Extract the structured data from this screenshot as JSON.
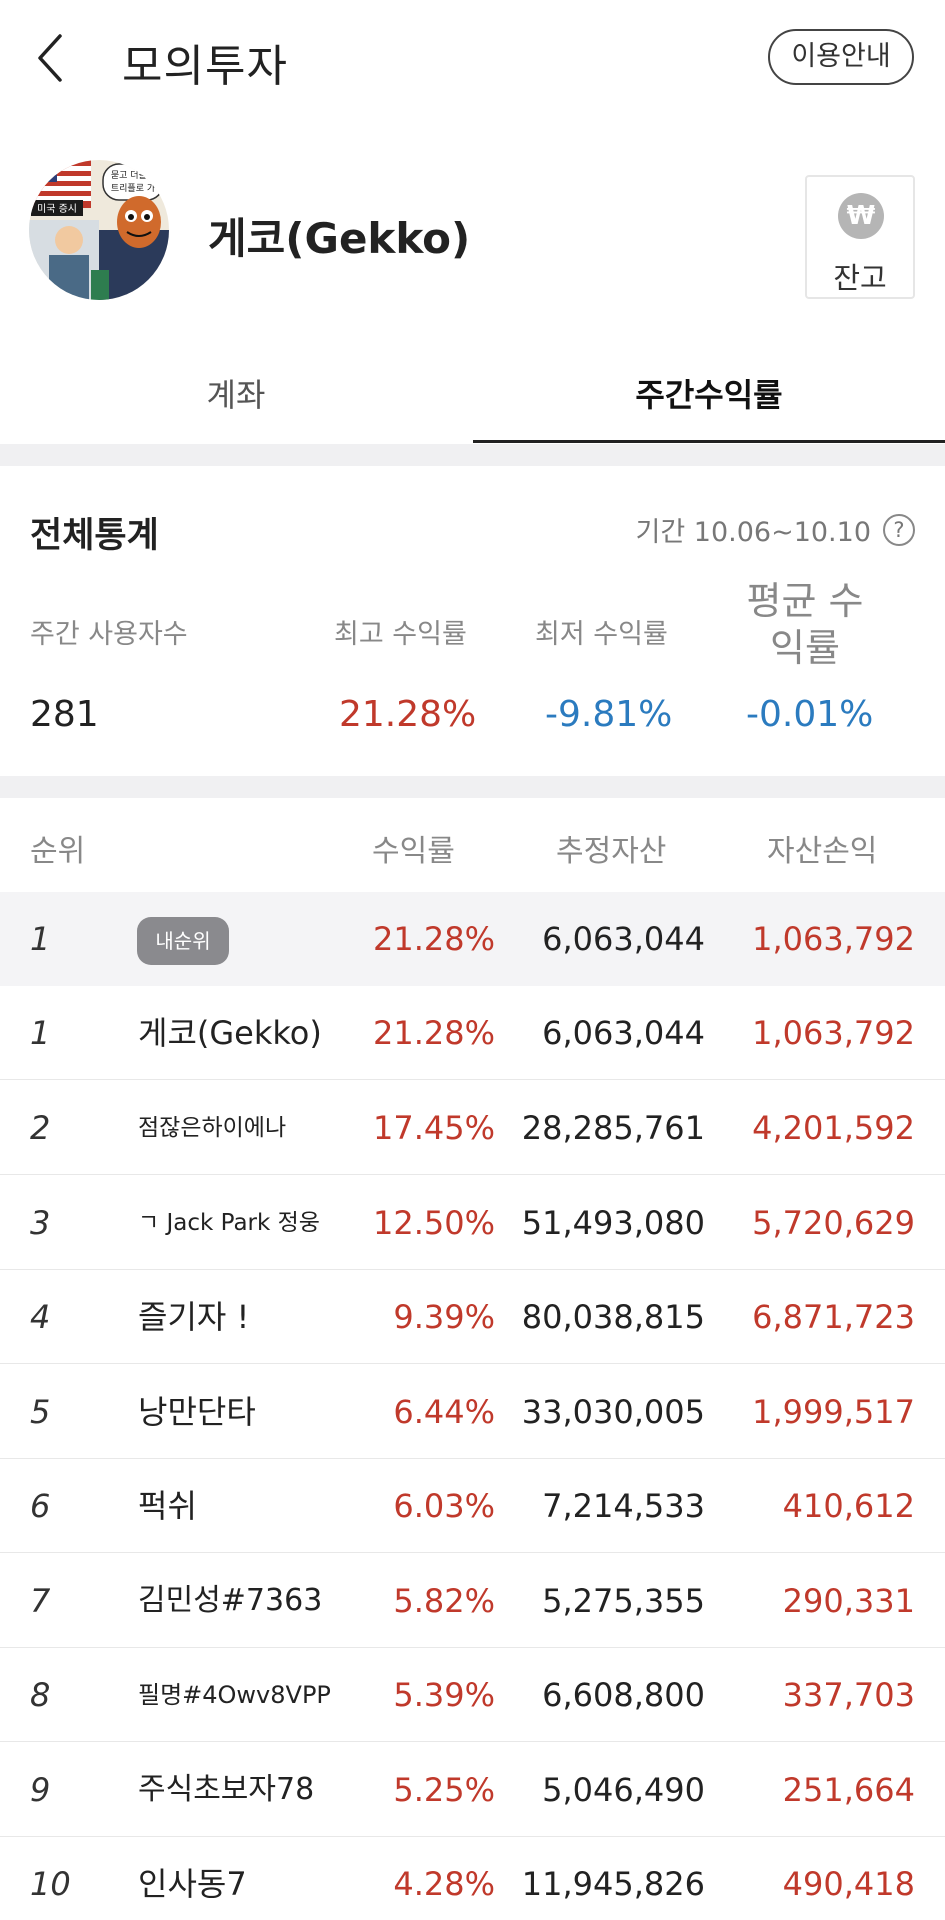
{
  "header": {
    "title": "모의투자",
    "guide_button": "이용안내"
  },
  "profile": {
    "name": "게코(Gekko)",
    "balance_label": "잔고",
    "balance_icon": "won-icon",
    "avatar_text": [
      "미국 증시",
      "묻고 더블로",
      "트리플로 가"
    ]
  },
  "tabs": [
    {
      "label": "계좌",
      "selected": false
    },
    {
      "label": "주간수익률",
      "selected": true
    }
  ],
  "stats": {
    "title": "전체통계",
    "period": "기간 10.06~10.10",
    "weekly_users_label": "주간 사용자수",
    "weekly_users": "281",
    "max_return_label": "최고 수익률",
    "max_return": "21.28%",
    "min_return_label": "최저 수익률",
    "min_return": "-9.81%",
    "avg_return_label": "평균 수익률",
    "avg_return": "-0.01%"
  },
  "table": {
    "headers": {
      "rank": "순위",
      "return": "수익률",
      "asset": "추정자산",
      "pnl": "자산손익"
    },
    "my_badge": "내순위",
    "my_row": {
      "rank": "1",
      "return": "21.28%",
      "asset": "6,063,044",
      "pnl": "1,063,792"
    },
    "rows": [
      {
        "rank": "1",
        "name": "게코(Gekko)",
        "return": "21.28%",
        "asset": "6,063,044",
        "pnl": "1,063,792"
      },
      {
        "rank": "2",
        "name": "점잖은하이에나",
        "return": "17.45%",
        "asset": "28,285,761",
        "pnl": "4,201,592"
      },
      {
        "rank": "3",
        "name": "ㄱ Jack Park 정웅",
        "return": "12.50%",
        "asset": "51,493,080",
        "pnl": "5,720,629"
      },
      {
        "rank": "4",
        "name": "즐기자 !",
        "return": "9.39%",
        "asset": "80,038,815",
        "pnl": "6,871,723"
      },
      {
        "rank": "5",
        "name": "낭만단타",
        "return": "6.44%",
        "asset": "33,030,005",
        "pnl": "1,999,517"
      },
      {
        "rank": "6",
        "name": "퍽쉬",
        "return": "6.03%",
        "asset": "7,214,533",
        "pnl": "410,612"
      },
      {
        "rank": "7",
        "name": "김민성#7363",
        "return": "5.82%",
        "asset": "5,275,355",
        "pnl": "290,331"
      },
      {
        "rank": "8",
        "name": "필명#4Owv8VPP",
        "return": "5.39%",
        "asset": "6,608,800",
        "pnl": "337,703"
      },
      {
        "rank": "9",
        "name": "주식초보자78",
        "return": "5.25%",
        "asset": "5,046,490",
        "pnl": "251,664"
      },
      {
        "rank": "10",
        "name": "인사동7",
        "return": "4.28%",
        "asset": "11,945,826",
        "pnl": "490,418"
      }
    ]
  },
  "colors": {
    "positive": "#c0392b",
    "negative": "#2b7bbf"
  }
}
